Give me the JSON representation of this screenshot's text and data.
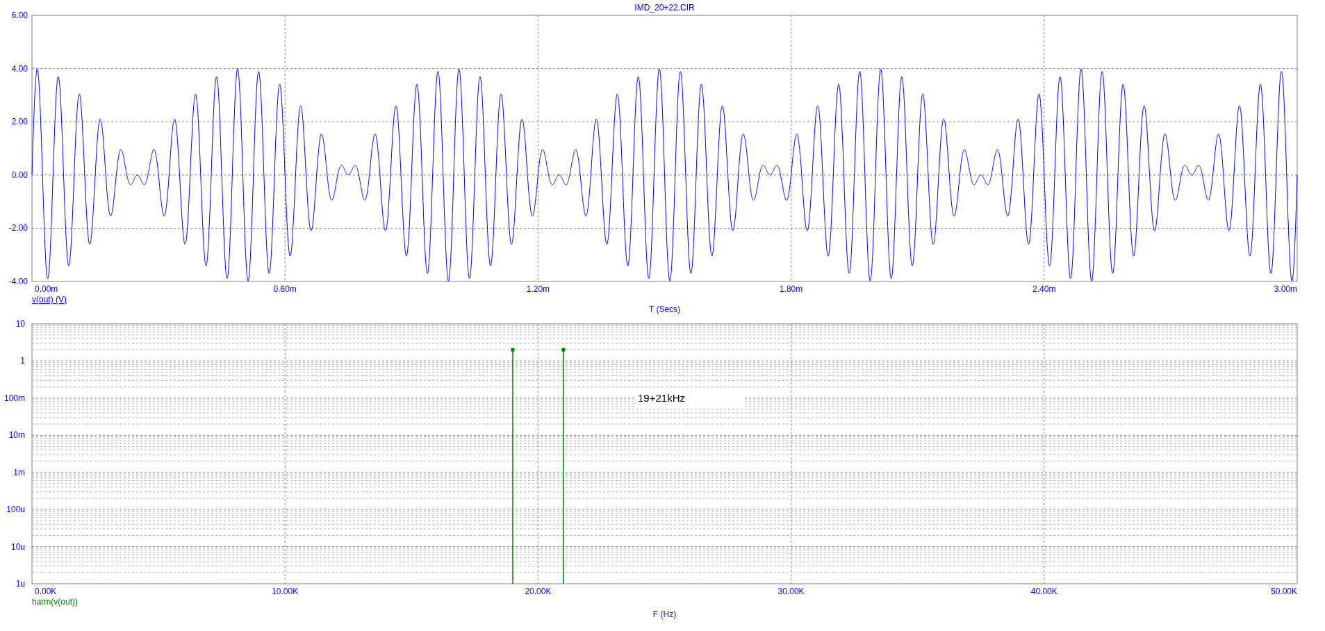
{
  "time_plot": {
    "title": "IMD_20+22.CIR",
    "y_tick_labels": [
      "6.00",
      "4.00",
      "2.00",
      "0.00",
      "-2.00",
      "-4.00"
    ],
    "x_tick_labels": [
      "0.00m",
      "0.60m",
      "1.20m",
      "1.80m",
      "2.40m",
      "3.00m"
    ],
    "trace_label": "v(out) (V)",
    "x_axis_label": "T (Secs)"
  },
  "spectrum_plot": {
    "y_tick_labels": [
      "10",
      "1",
      "100m",
      "10m",
      "1m",
      "100u",
      "10u",
      "1u"
    ],
    "x_tick_labels": [
      "0.00K",
      "10.00K",
      "20.00K",
      "30.00K",
      "40.00K",
      "50.00K"
    ],
    "annotation": "19+21kHz",
    "trace_label": "harm(v(out))",
    "x_axis_label": "F (Hz)"
  }
}
